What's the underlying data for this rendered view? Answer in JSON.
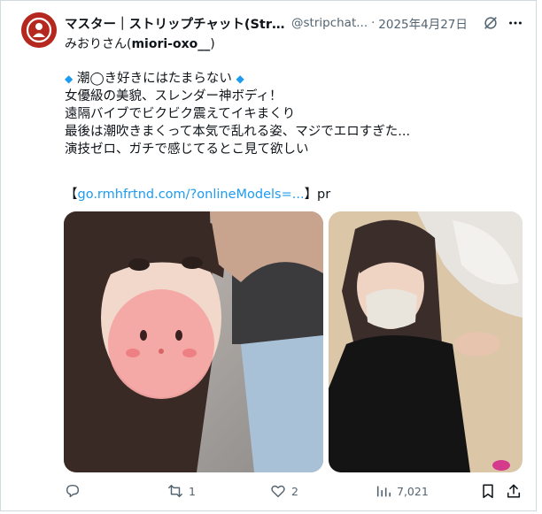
{
  "tweet": {
    "display_name": "マスター｜ストリップチャット(Stri...",
    "handle": "@stripchat...",
    "date": "2025年4月27日",
    "subname_prefix": "みおりさん(",
    "subname_bold": "miori-oxo__",
    "subname_suffix": ")",
    "body_lines": [
      "潮◯き好きにはたまらない",
      "女優級の美貌、スレンダー神ボディ！",
      "遠隔バイブでビクビク震えてイキまくり",
      "最後は潮吹きまくって本気で乱れる姿、マジでエロすぎた...",
      "演技ゼロ、ガチで感じてるとこ見て欲しい"
    ],
    "diamond_left": "◆",
    "diamond_right": "◆",
    "link_open": "【",
    "link_text": "go.rmhfrtnd.com/?onlineModels=...",
    "link_close": "】pr"
  },
  "actions": {
    "reply_count": "",
    "retweet_count": "1",
    "like_count": "2",
    "views_count": "7,021"
  },
  "icons": {
    "avatar": "stripchat-logo-icon",
    "grok": "grok-icon",
    "more": "more-icon",
    "reply": "reply-icon",
    "retweet": "retweet-icon",
    "like": "heart-icon",
    "views": "views-icon",
    "bookmark": "bookmark-icon",
    "share": "share-icon"
  },
  "colors": {
    "link": "#1d9bf0",
    "muted": "#536471",
    "avatar_bg": "#b5281f"
  }
}
